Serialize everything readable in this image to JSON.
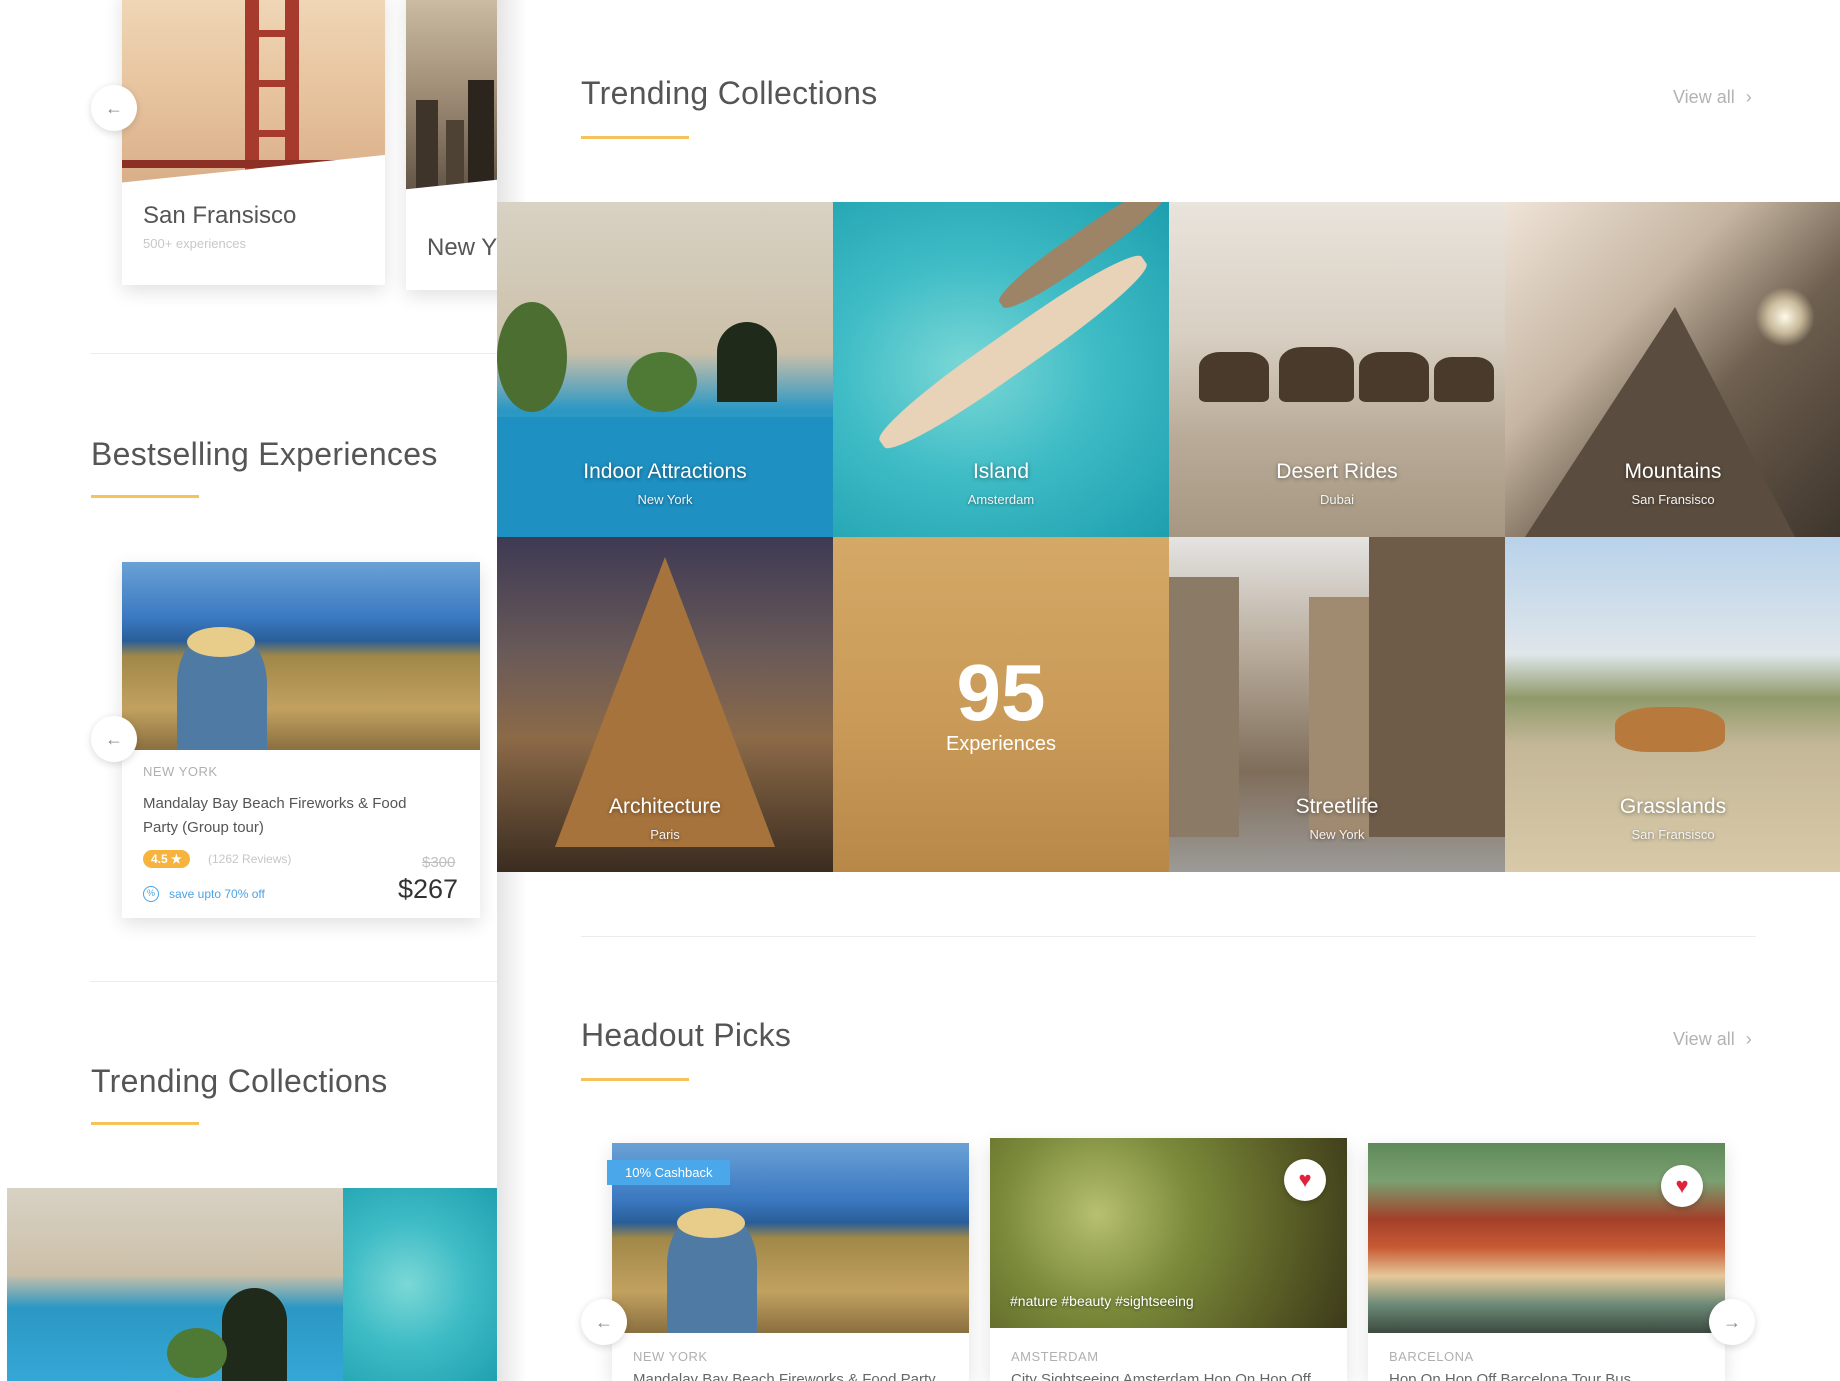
{
  "left": {
    "city_cards": [
      {
        "name": "San Fransisco",
        "sub": "500+ experiences"
      },
      {
        "name": "New Y"
      }
    ],
    "bestselling_title": "Bestselling Experiences",
    "experience": {
      "location": "NEW YORK",
      "title": "Mandalay Bay Beach Fireworks & Food Party (Group tour)",
      "rating": "4.5 ★",
      "reviews": "(1262 Reviews)",
      "old_price": "$300",
      "price": "$267",
      "save": "save upto 70% off"
    },
    "trending_title": "Trending Collections"
  },
  "main": {
    "trending_title": "Trending Collections",
    "view_all": "View all",
    "collections": [
      {
        "name": "Indoor Attractions",
        "city": "New York"
      },
      {
        "name": "Island",
        "city": "Amsterdam"
      },
      {
        "name": "Desert Rides",
        "city": "Dubai"
      },
      {
        "name": "Mountains",
        "city": "San Fransisco"
      },
      {
        "name": "Architecture",
        "city": "Paris"
      },
      {
        "count": "95",
        "label": "Experiences"
      },
      {
        "name": "Streetlife",
        "city": "New York"
      },
      {
        "name": "Grasslands",
        "city": "San Fransisco"
      }
    ],
    "picks_title": "Headout Picks",
    "picks_view_all": "View all",
    "picks": [
      {
        "badge": "10% Cashback",
        "location": "NEW YORK",
        "title": "Mandalay Bay Beach Fireworks & Food Party"
      },
      {
        "tags": "#nature #beauty #sightseeing",
        "location": "AMSTERDAM",
        "title": "City Sightseeing Amsterdam Hop On Hop Off"
      },
      {
        "location": "BARCELONA",
        "title": "Hop On Hop Off Barcelona Tour Bus"
      }
    ]
  },
  "icons": {
    "arrow_left": "←",
    "arrow_right": "→",
    "chevron_right": "›",
    "heart": "♥",
    "percent": "%"
  },
  "colors": {
    "accent": "#f6c25b",
    "rating": "#f6b33d",
    "link_blue": "#4aa3e6",
    "heart_red": "#e0233a"
  }
}
